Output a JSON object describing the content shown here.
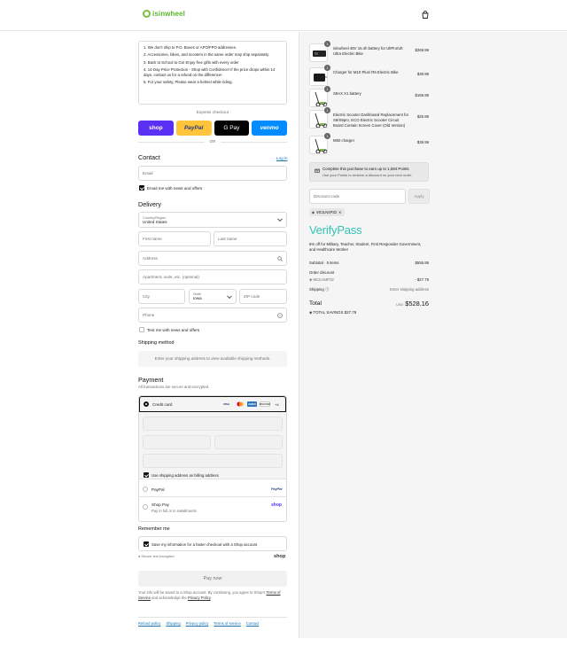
{
  "header": {
    "brand": "isinwheel"
  },
  "notice": {
    "items": [
      "1. We don't ship to P.O. Boxes or APO/FPO addresses.",
      "2. Accessories, bikes, and scooters in the same order may ship separately.",
      "3. Back to School to Go! Enjoy free gifts with every order",
      "4. 14-Day Price Protection - Shop with Confidence! If the price drops within 14 days, contact us for a refund on the difference!",
      "5. For your safety, Please wear a helmet while riding."
    ]
  },
  "express": {
    "label": "Express checkout",
    "shop": "shop",
    "paypal": "PayPal",
    "gpay": "G Pay",
    "venmo": "venmo",
    "or": "OR"
  },
  "contact": {
    "heading": "Contact",
    "login": "Log in",
    "email_placeholder": "Email",
    "email_news": "Email me with news and offers"
  },
  "delivery": {
    "heading": "Delivery",
    "country_label": "Country/Region",
    "country_value": "United States",
    "first_name": "First name",
    "last_name": "Last name",
    "address": "Address",
    "apartment": "Apartment, suite, etc. (optional)",
    "city": "City",
    "state_label": "State",
    "state_value": "Iowa",
    "zip": "ZIP code",
    "phone": "Phone",
    "text_news": "Text me with news and offers"
  },
  "shipping": {
    "heading": "Shipping method",
    "message": "Enter your shipping address to view available shipping methods."
  },
  "payment": {
    "heading": "Payment",
    "subtitle": "All transactions are secure and encrypted.",
    "credit_card": "Credit card",
    "more_cards": "+4",
    "billing_same": "Use shipping address as billing address",
    "paypal": "PayPal",
    "shop_pay": "Shop Pay",
    "shop_pay_sub": "Pay in full or in installments"
  },
  "remember": {
    "heading": "Remember me",
    "save": "Save my information for a faster checkout with a Shop account",
    "secure": "Secure and encrypted",
    "shop": "shop"
  },
  "pay_now": "Pay now",
  "fine_print": {
    "part1": "Your info will be saved to a Shop account. By continuing, you agree to Shop's ",
    "tos": "Terms of Service",
    "part2": " and acknowledge the ",
    "privacy": "Privacy Policy",
    "part3": "."
  },
  "footer": [
    "Refund policy",
    "Shipping",
    "Privacy policy",
    "Terms of service",
    "Contact"
  ],
  "cart": {
    "items": [
      {
        "qty": "1",
        "name": "isinwheel 48V 16.4h battery for UltPro/Ult Ultra Electric Bike",
        "price": "$269.99"
      },
      {
        "qty": "1",
        "name": "Charger for M10 Plus/ R6 Electric Bike",
        "price": "$39.99"
      },
      {
        "qty": "1",
        "name": "S9AX X1 battery",
        "price": "$169.99"
      },
      {
        "qty": "1",
        "name": "Electric Scooter Dashboard Replacement for S9/S9pro, ECO Electric Scooter Circuit Board Contain Screen Cover (Old Version)",
        "price": "$25.99"
      },
      {
        "qty": "1",
        "name": "M60 charger",
        "price": "$39.99"
      }
    ],
    "points_title": "Complete this purchase to earn up to 1,584 Points",
    "points_sub": "Use your Points to redeem a discount on your next order.",
    "discount_placeholder": "Discount code",
    "apply": "Apply",
    "applied_code": "9ICILN4P32",
    "verifypass": "VerifyPass",
    "verifypass_desc": "6% off for Military, Teacher, Student, First Responder Government, and Healthcare Worker",
    "subtotal_label": "Subtotal · 5 items",
    "subtotal": "$555.95",
    "order_discount_label": "Order discount",
    "discount_code": "9ICILN4P32",
    "discount_amount": "- $27.79",
    "shipping_label": "Shipping",
    "shipping_value": "Enter shipping address",
    "total_label": "Total",
    "currency": "USD",
    "total": "$528.16",
    "savings_label": "TOTAL SAVINGS",
    "savings": "$27.79"
  }
}
